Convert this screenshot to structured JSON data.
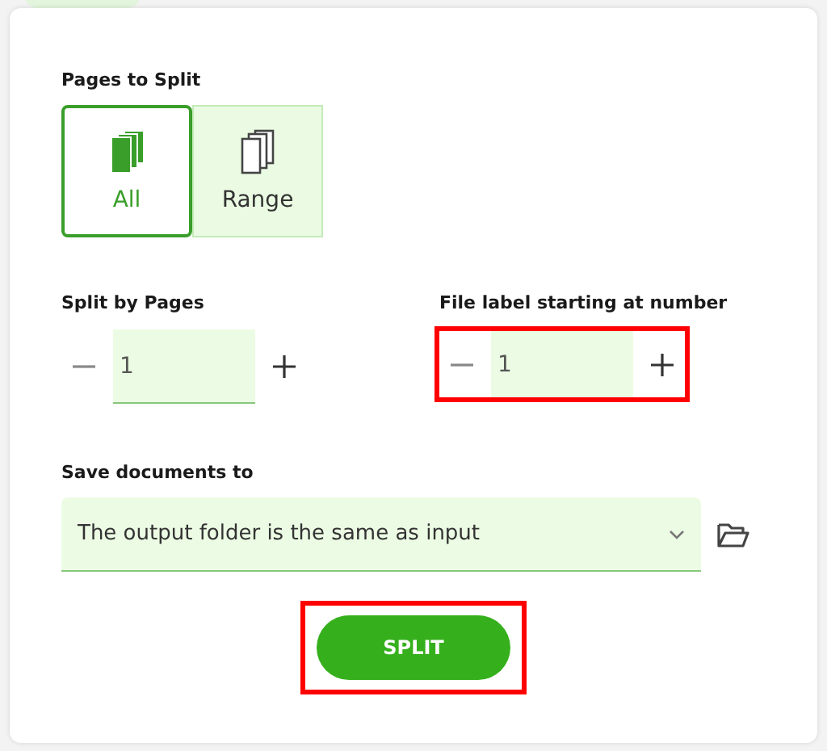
{
  "pages_to_split": {
    "label": "Pages to Split",
    "options": [
      {
        "label": "All",
        "selected": true,
        "kind": "all"
      },
      {
        "label": "Range",
        "selected": false,
        "kind": "range"
      }
    ]
  },
  "steppers": [
    {
      "label": "Split by Pages",
      "value": "1",
      "highlighted": false
    },
    {
      "label": "File label starting at number",
      "value": "1",
      "highlighted": true
    }
  ],
  "save": {
    "label": "Save documents to",
    "value": "The output folder is the same as input"
  },
  "split_button": {
    "label": "SPLIT",
    "highlighted": true
  }
}
